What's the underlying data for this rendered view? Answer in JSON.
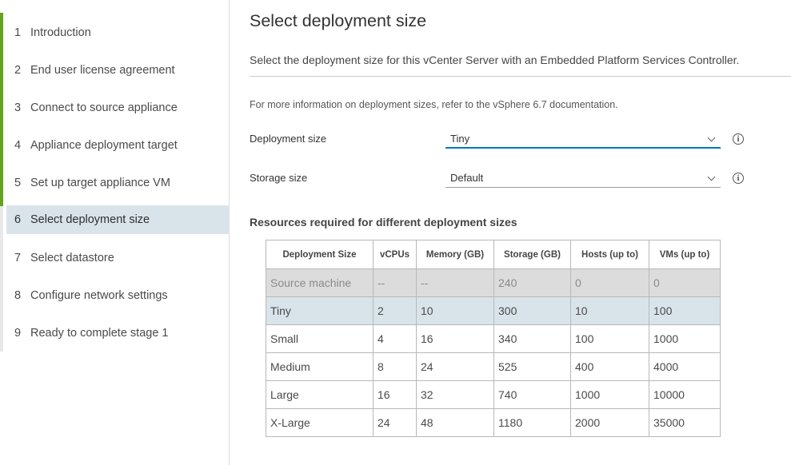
{
  "sidebar": {
    "steps": [
      {
        "num": "1",
        "label": "Introduction"
      },
      {
        "num": "2",
        "label": "End user license agreement"
      },
      {
        "num": "3",
        "label": "Connect to source appliance"
      },
      {
        "num": "4",
        "label": "Appliance deployment target"
      },
      {
        "num": "5",
        "label": "Set up target appliance VM"
      },
      {
        "num": "6",
        "label": "Select deployment size"
      },
      {
        "num": "7",
        "label": "Select datastore"
      },
      {
        "num": "8",
        "label": "Configure network settings"
      },
      {
        "num": "9",
        "label": "Ready to complete stage 1"
      }
    ],
    "active_step": 6,
    "progress_color": "#62a420"
  },
  "main": {
    "title": "Select deployment size",
    "subtitle": "Select the deployment size for this vCenter Server with an Embedded Platform Services Controller.",
    "info_text": "For more information on deployment sizes, refer to the vSphere 6.7 documentation.",
    "deployment_size": {
      "label": "Deployment size",
      "value": "Tiny"
    },
    "storage_size": {
      "label": "Storage size",
      "value": "Default"
    },
    "section_heading": "Resources required for different deployment sizes",
    "table": {
      "headers": [
        "Deployment Size",
        "vCPUs",
        "Memory (GB)",
        "Storage (GB)",
        "Hosts (up to)",
        "VMs (up to)"
      ],
      "rows": [
        [
          "Source machine",
          "--",
          "--",
          "240",
          "0",
          "0"
        ],
        [
          "Tiny",
          "2",
          "10",
          "300",
          "10",
          "100"
        ],
        [
          "Small",
          "4",
          "16",
          "340",
          "100",
          "1000"
        ],
        [
          "Medium",
          "8",
          "24",
          "525",
          "400",
          "4000"
        ],
        [
          "Large",
          "16",
          "32",
          "740",
          "1000",
          "10000"
        ],
        [
          "X-Large",
          "24",
          "48",
          "1180",
          "2000",
          "35000"
        ]
      ]
    },
    "accent_color": "#0079b8",
    "selected_row_color": "#d9e4ea"
  }
}
